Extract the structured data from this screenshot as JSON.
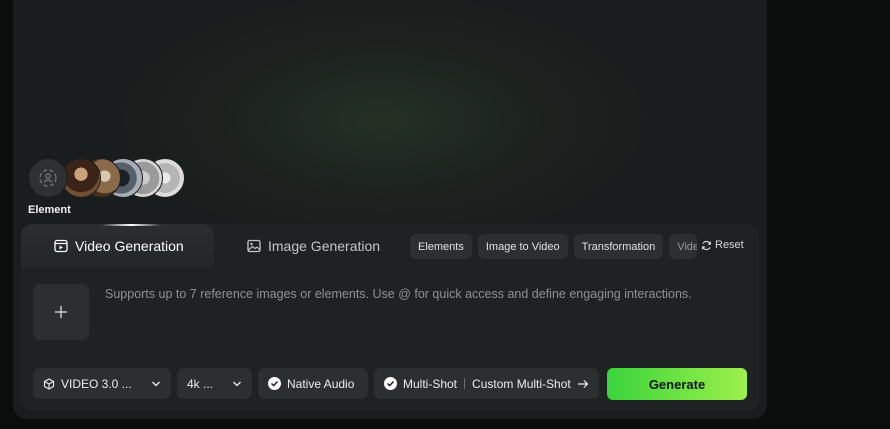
{
  "element_section": {
    "label": "Element"
  },
  "tabs": [
    {
      "label": "Video Generation",
      "icon": "video-icon",
      "active": true
    },
    {
      "label": "Image Generation",
      "icon": "image-icon",
      "active": false
    }
  ],
  "chips": [
    "Elements",
    "Image to Video",
    "Transformation",
    "Video"
  ],
  "reset_label": "Reset",
  "prompt_placeholder": "Supports up to 7 reference images or elements. Use @ for quick access and define engaging interactions.",
  "toolbar": {
    "model": "VIDEO 3.0 ...",
    "resolution": "4k ...",
    "native_audio": "Native Audio",
    "multi_shot": "Multi-Shot",
    "custom_multi_shot": "Custom Multi-Shot",
    "generate": "Generate"
  },
  "colors": {
    "accent_start": "#3bd43c",
    "accent_end": "#9ef04b"
  }
}
